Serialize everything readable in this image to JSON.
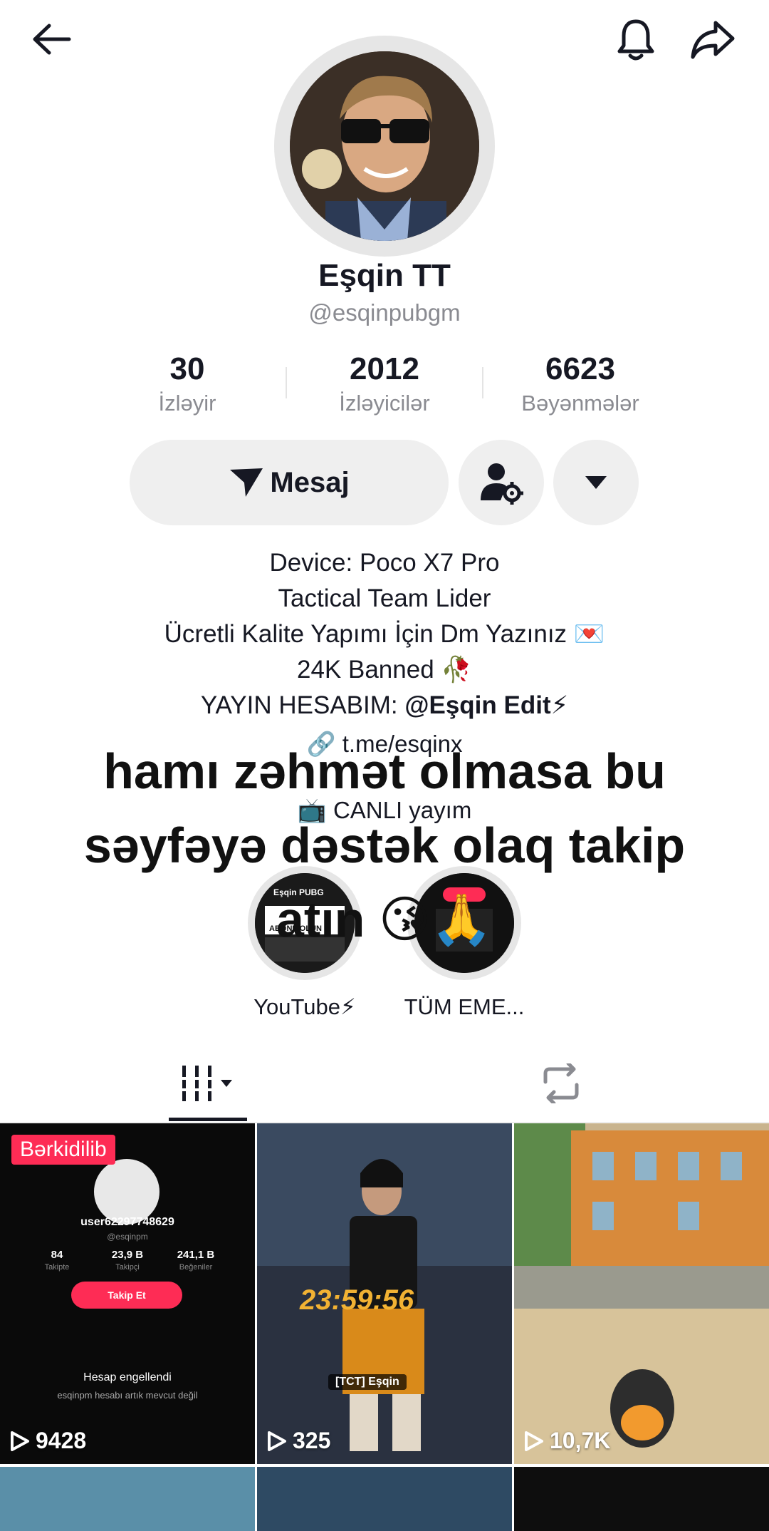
{
  "header": {
    "back_icon": "arrow-left-icon",
    "bell_icon": "bell-icon",
    "share_icon": "share-arrow-icon"
  },
  "profile": {
    "name": "Eşqin TT",
    "handle": "@esqinpubgm"
  },
  "stats": [
    {
      "value": "30",
      "label": "İzləyir"
    },
    {
      "value": "2012",
      "label": "İzləyicilər"
    },
    {
      "value": "6623",
      "label": "Bəyənmələr"
    }
  ],
  "actions": {
    "message_label": "Mesaj",
    "follow_settings_icon": "user-gear-icon",
    "more_icon": "caret-down-icon"
  },
  "bio": {
    "lines": [
      "Device: Poco X7 Pro",
      "Tactical Team Lider",
      "Ücretli Kalite Yapımı İçin Dm Yazınız 💌",
      "24K Banned 🥀"
    ],
    "yayin_prefix": "YAYIN HESABIM: ",
    "yayin_mention": "@Eşqin Edit⚡",
    "link": "t.me/esqinx",
    "live": "CANLI yayım"
  },
  "overlay_text": "hamı zəhmət olmasa bu səyfəyə dəstək olaq takip atın 😘🙏",
  "highlights": [
    {
      "label": "YouTube⚡",
      "preview_title": "Eşqin PUBG",
      "preview_sub": "ABONE OLUN"
    },
    {
      "label": "TÜM EME..."
    }
  ],
  "tabs": {
    "videos_icon": "grid-bars-icon",
    "repost_icon": "repost-icon"
  },
  "videos": [
    {
      "pinned_label": "Bərkidilib",
      "views": "9428",
      "inner_user": "user62297748629",
      "inner_handle": "@esqinpm",
      "inner_stats": [
        {
          "value": "84",
          "label": "Takipte"
        },
        {
          "value": "23,9 B",
          "label": "Takipçi"
        },
        {
          "value": "241,1 B",
          "label": "Beğeniler"
        }
      ],
      "inner_button": "Takip Et",
      "inner_notice": "Hesap engellendi",
      "inner_notice_sub": "esqinpm hesabı artık mevcut değil"
    },
    {
      "views": "325",
      "tag": "[TCT] Eşqin",
      "timer": "23:59:56"
    },
    {
      "views": "10,7K"
    }
  ],
  "colors": {
    "accent": "#fe2c55",
    "button_bg": "#efefef",
    "muted": "#8a8b91"
  }
}
